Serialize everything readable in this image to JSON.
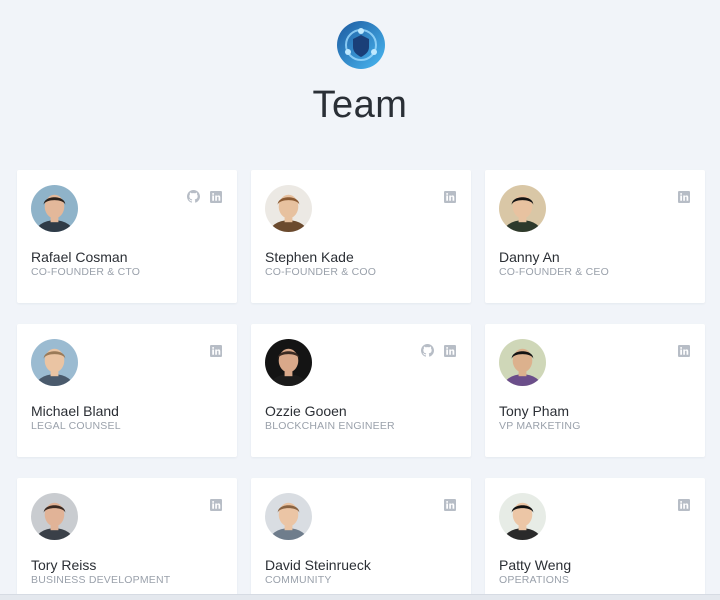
{
  "header": {
    "title": "Team"
  },
  "team": [
    {
      "name": "Rafael Cosman",
      "role": "CO-FOUNDER & CTO",
      "github": true,
      "linkedin": true,
      "skin": "#e3b89a",
      "hair": "#2b221c",
      "bg": "#8fb3c9",
      "shirt": "#2f3b47"
    },
    {
      "name": "Stephen Kade",
      "role": "CO-FOUNDER & COO",
      "github": false,
      "linkedin": true,
      "skin": "#e7c19f",
      "hair": "#8a5a33",
      "bg": "#ece9e4",
      "shirt": "#6b4a2e"
    },
    {
      "name": "Danny An",
      "role": "CO-FOUNDER & CEO",
      "github": false,
      "linkedin": true,
      "skin": "#e8c2a0",
      "hair": "#141414",
      "bg": "#d9c7a6",
      "shirt": "#2e3a2c"
    },
    {
      "name": "Michael Bland",
      "role": "LEGAL COUNSEL",
      "github": false,
      "linkedin": true,
      "skin": "#eac4a3",
      "hair": "#9a7a58",
      "bg": "#9bbbd1",
      "shirt": "#4a5a6c"
    },
    {
      "name": "Ozzie Gooen",
      "role": "BLOCKCHAIN ENGINEER",
      "github": true,
      "linkedin": true,
      "skin": "#d9a88a",
      "hair": "#3a2a22",
      "bg": "#141414",
      "shirt": "#1b1b1b"
    },
    {
      "name": "Tony Pham",
      "role": "VP MARKETING",
      "github": false,
      "linkedin": true,
      "skin": "#dcb18d",
      "hair": "#141414",
      "bg": "#cfd7b8",
      "shirt": "#6b4e8a"
    },
    {
      "name": "Tory Reiss",
      "role": "BUSINESS DEVELOPMENT",
      "github": false,
      "linkedin": true,
      "skin": "#e1b397",
      "hair": "#3b2a22",
      "bg": "#c9ccd0",
      "shirt": "#3a4048"
    },
    {
      "name": "David Steinrueck",
      "role": "COMMUNITY",
      "github": false,
      "linkedin": true,
      "skin": "#ebc5a5",
      "hair": "#8a6443",
      "bg": "#d9dde2",
      "shirt": "#6f7d8c"
    },
    {
      "name": "Patty Weng",
      "role": "OPERATIONS",
      "github": false,
      "linkedin": true,
      "skin": "#ecc6a6",
      "hair": "#111111",
      "bg": "#e7ece6",
      "shirt": "#2a2a2a"
    }
  ],
  "colors": {
    "icon": "#b7bdc6",
    "logo_dark": "#1f62a8",
    "logo_light": "#45b6f0"
  }
}
